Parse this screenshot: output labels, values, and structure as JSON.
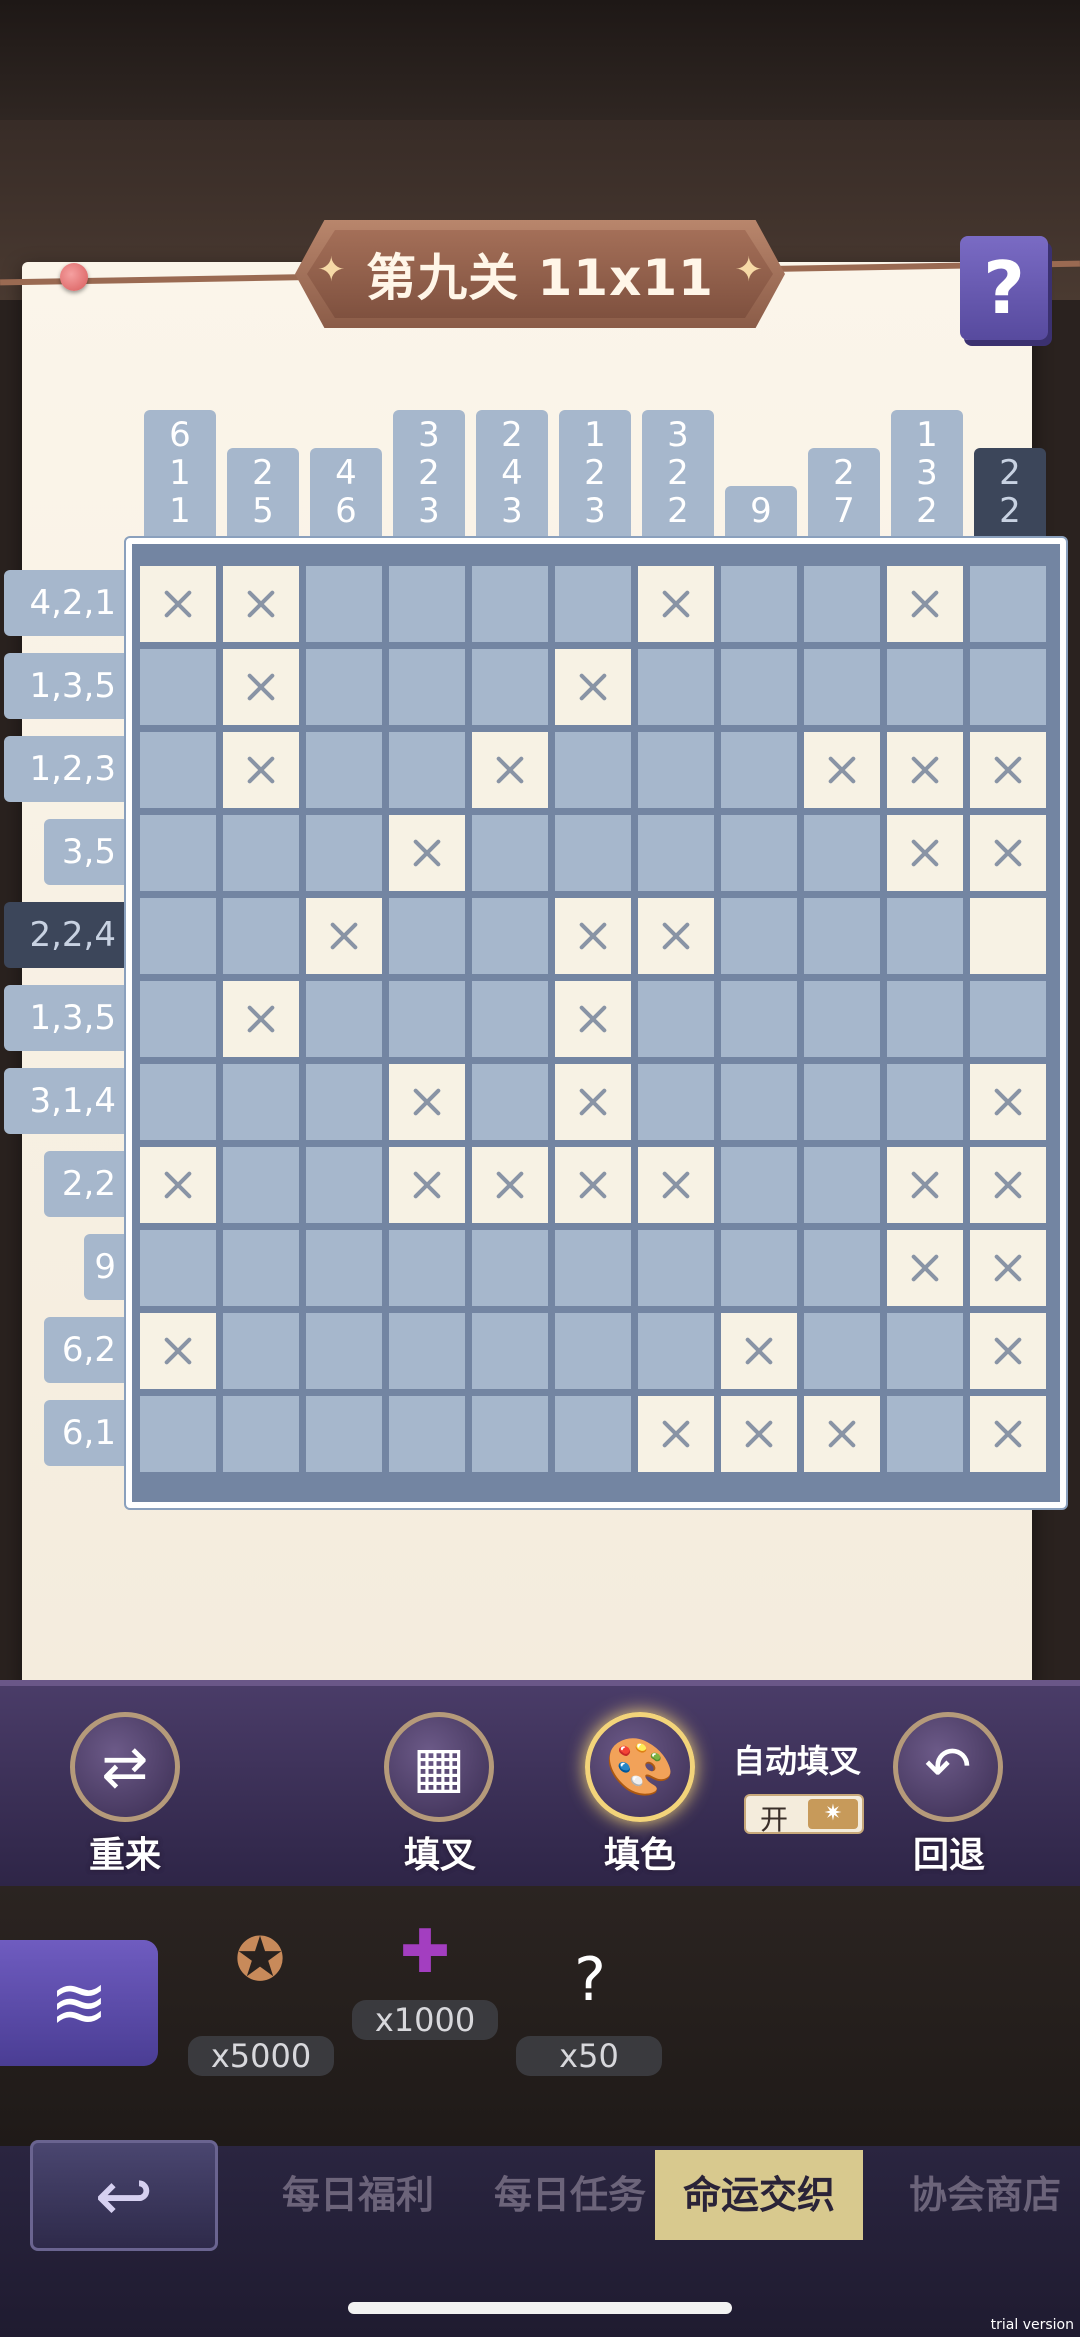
{
  "header": {
    "title": "第九关 11x11"
  },
  "help_label": "?",
  "col_clues": [
    [
      "6",
      "1",
      "1"
    ],
    [
      "2",
      "5"
    ],
    [
      "4",
      "6"
    ],
    [
      "3",
      "2",
      "3"
    ],
    [
      "2",
      "4",
      "3"
    ],
    [
      "1",
      "2",
      "3"
    ],
    [
      "3",
      "2",
      "2"
    ],
    [
      "9"
    ],
    [
      "2",
      "7"
    ],
    [
      "1",
      "3",
      "2"
    ],
    [
      "2",
      "2"
    ]
  ],
  "row_clues": [
    "4,2,1",
    "1,3,5",
    "1,2,3",
    "3,5",
    "2,2,4",
    "1,3,5",
    "3,1,4",
    "2,2",
    "9",
    "6,2",
    "6,1"
  ],
  "active_col": 10,
  "active_row": 4,
  "grid": [
    "xx....x..x.",
    ".x...x.....",
    ".x..x...xxx",
    "...x.....xx",
    "..x..xx...e",
    ".x...x.....",
    "...x.x....x",
    "x..xxxx..xx",
    ".........xx",
    "x......x..x",
    "......xxx.x"
  ],
  "toolbar": {
    "restart": "重来",
    "fill_x": "填叉",
    "fill_color": "填色",
    "autofill_label": "自动填叉",
    "autofill_state": "开",
    "undo": "回退"
  },
  "rewards": [
    {
      "icon": "wing-badge-icon",
      "count": "x5000"
    },
    {
      "icon": "puzzle-piece-icon",
      "count": "x1000"
    },
    {
      "icon": "mystery-card-icon",
      "count": "x50"
    }
  ],
  "nav": {
    "tabs": [
      "每日福利",
      "每日任务",
      "命运交织",
      "协会商店"
    ],
    "active": 2
  },
  "trial_text": "trial version"
}
